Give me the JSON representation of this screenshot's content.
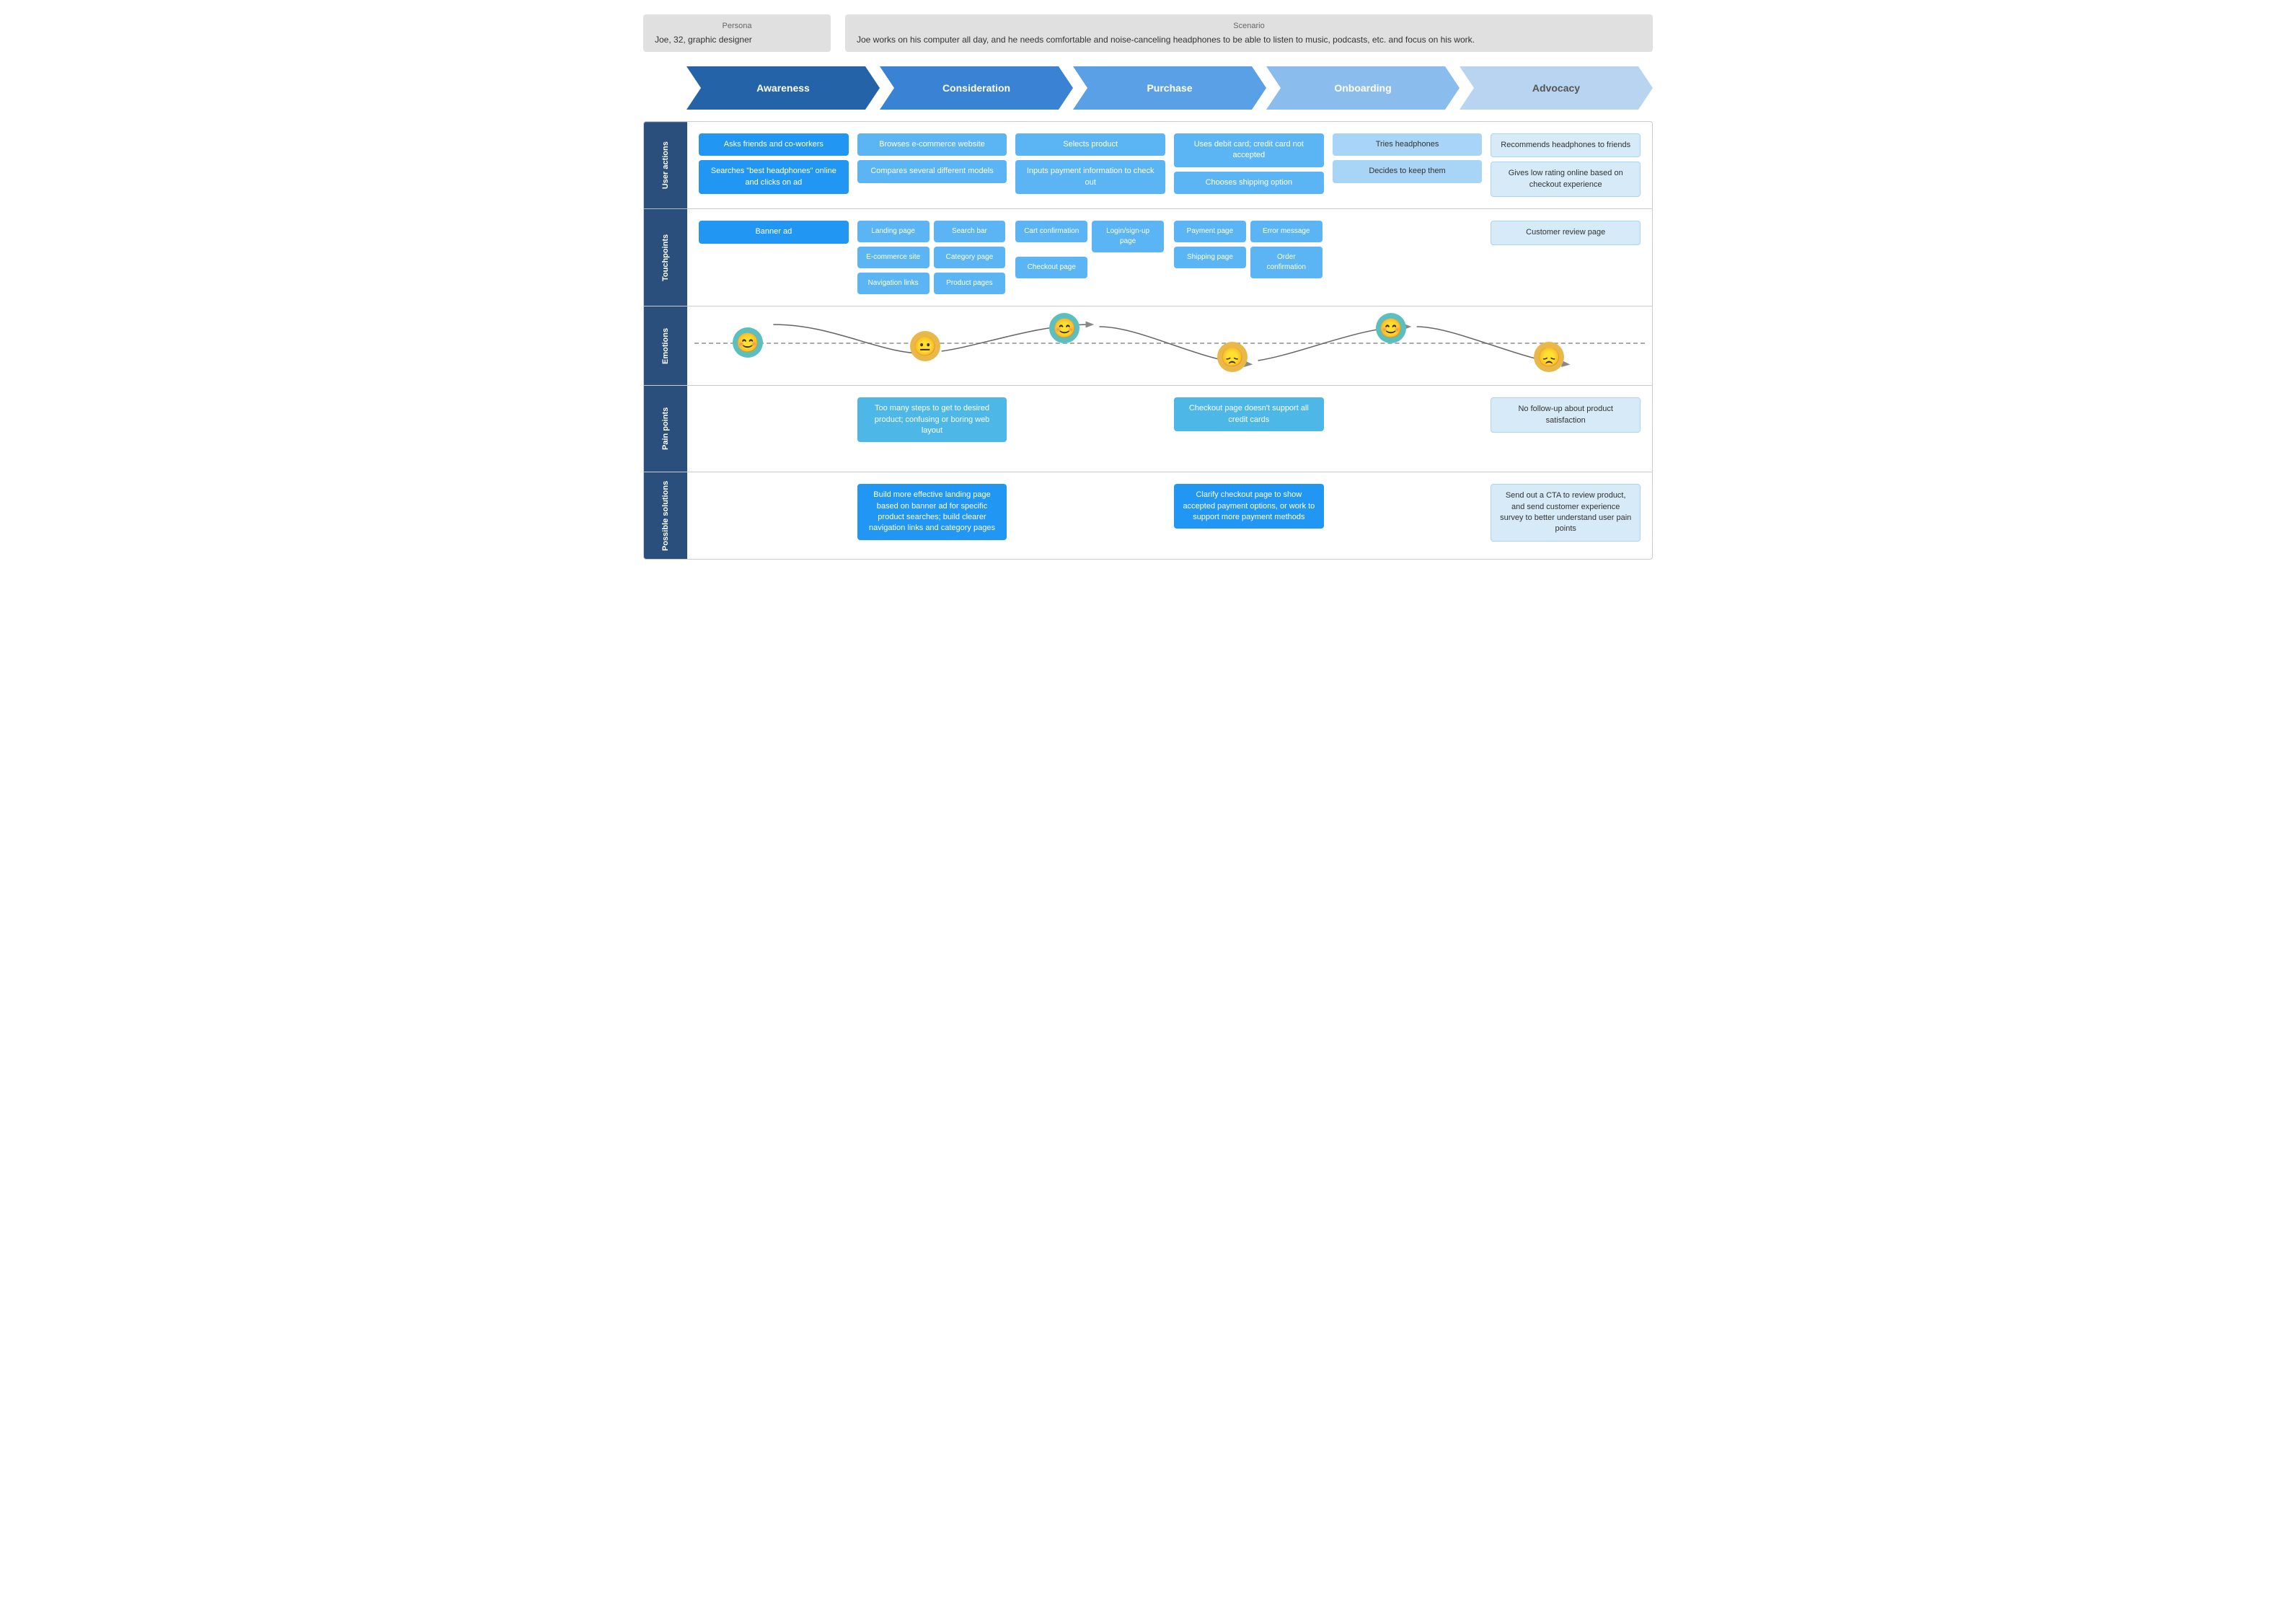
{
  "top": {
    "persona_label": "Persona",
    "persona_value": "Joe, 32, graphic designer",
    "scenario_label": "Scenario",
    "scenario_value": "Joe works on his computer all day, and he needs comfortable and noise-canceling headphones to be able to listen to music, podcasts, etc. and focus on his work."
  },
  "stages": [
    {
      "id": "awareness",
      "label": "Awareness",
      "class": "stage-awareness"
    },
    {
      "id": "consideration",
      "label": "Consideration",
      "class": "stage-consideration"
    },
    {
      "id": "purchase",
      "label": "Purchase",
      "class": "stage-purchase"
    },
    {
      "id": "onboarding",
      "label": "Onboarding",
      "class": "stage-onboarding"
    },
    {
      "id": "advocacy",
      "label": "Advocacy",
      "class": "stage-advocacy"
    }
  ],
  "rows": {
    "user_actions": {
      "label": "User actions",
      "cols": [
        {
          "cards": [
            {
              "text": "Asks friends and co-workers",
              "type": "blue-dark"
            },
            {
              "text": "Searches \"best headphones\" online and clicks on ad",
              "type": "blue-dark"
            }
          ]
        },
        {
          "cards": [
            {
              "text": "Browses e-commerce website",
              "type": "blue-mid"
            },
            {
              "text": "Compares several different models",
              "type": "blue-mid"
            }
          ]
        },
        {
          "cards": [
            {
              "text": "Selects product",
              "type": "blue-mid"
            },
            {
              "text": "Inputs payment information to check out",
              "type": "blue-mid"
            }
          ]
        },
        {
          "cards": [
            {
              "text": "Uses debit card; credit card not accepted",
              "type": "blue-mid"
            },
            {
              "text": "Chooses shipping option",
              "type": "blue-mid"
            }
          ]
        },
        {
          "cards": [
            {
              "text": "Tries headphones",
              "type": "blue-light"
            },
            {
              "text": "Decides to keep them",
              "type": "blue-light"
            }
          ]
        },
        {
          "cards": [
            {
              "text": "Recommends headphones to friends",
              "type": "blue-outline"
            },
            {
              "text": "Gives low rating online based on checkout experience",
              "type": "blue-outline"
            }
          ]
        }
      ]
    },
    "touchpoints": {
      "label": "Touchpoints",
      "cols": [
        {
          "cards": [
            {
              "text": "Banner ad",
              "type": "blue-dark"
            }
          ]
        },
        {
          "cards": [
            {
              "text": "Landing page",
              "type": "blue-mid"
            },
            {
              "text": "Search bar",
              "type": "blue-mid"
            },
            {
              "text": "E-commerce site",
              "type": "blue-mid"
            },
            {
              "text": "Category page",
              "type": "blue-mid"
            },
            {
              "text": "Navigation links",
              "type": "blue-mid"
            },
            {
              "text": "Product pages",
              "type": "blue-mid"
            }
          ]
        },
        {
          "cards": [
            {
              "text": "Cart confirmation",
              "type": "blue-mid"
            },
            {
              "text": "Login/sign-up page",
              "type": "blue-mid"
            },
            {
              "text": "Checkout page",
              "type": "blue-mid"
            }
          ]
        },
        {
          "cards": [
            {
              "text": "Payment page",
              "type": "blue-mid"
            },
            {
              "text": "Error message",
              "type": "blue-mid"
            },
            {
              "text": "Shipping page",
              "type": "blue-mid"
            },
            {
              "text": "Order confirmation",
              "type": "blue-mid"
            }
          ]
        },
        {
          "cards": []
        },
        {
          "cards": [
            {
              "text": "Customer review page",
              "type": "blue-outline"
            }
          ]
        }
      ]
    },
    "pain_points": {
      "label": "Pain points",
      "cols": [
        {
          "cards": []
        },
        {
          "cards": [
            {
              "text": "Too many steps to get to desired product; confusing or boring web layout",
              "type": "pain"
            }
          ]
        },
        {
          "cards": []
        },
        {
          "cards": [
            {
              "text": "Checkout page doesn't support all credit cards",
              "type": "pain"
            }
          ]
        },
        {
          "cards": []
        },
        {
          "cards": [
            {
              "text": "No follow-up about product satisfaction",
              "type": "blue-outline"
            }
          ]
        }
      ]
    },
    "possible_solutions": {
      "label": "Possible solutions",
      "cols": [
        {
          "cards": []
        },
        {
          "cards": [
            {
              "text": "Build more effective landing page based on banner ad for specific product searches; build clearer navigation links and category pages",
              "type": "solution"
            }
          ]
        },
        {
          "cards": []
        },
        {
          "cards": [
            {
              "text": "Clarify checkout page to show accepted payment options, or work to support more payment methods",
              "type": "solution"
            }
          ]
        },
        {
          "cards": []
        },
        {
          "cards": [
            {
              "text": "Send out a CTA to review product, and send customer experience survey to better understand user pain points",
              "type": "blue-outline"
            }
          ]
        }
      ]
    }
  },
  "emotions": {
    "label": "Emotions",
    "faces": [
      {
        "type": "happy",
        "stage": 0
      },
      {
        "type": "neutral",
        "stage": 1
      },
      {
        "type": "happy",
        "stage": 2
      },
      {
        "type": "sad",
        "stage": 3
      },
      {
        "type": "happy",
        "stage": 4
      },
      {
        "type": "sad",
        "stage": 5
      }
    ]
  },
  "icons": {
    "happy": "😊",
    "neutral": "😐",
    "sad": "😞"
  }
}
